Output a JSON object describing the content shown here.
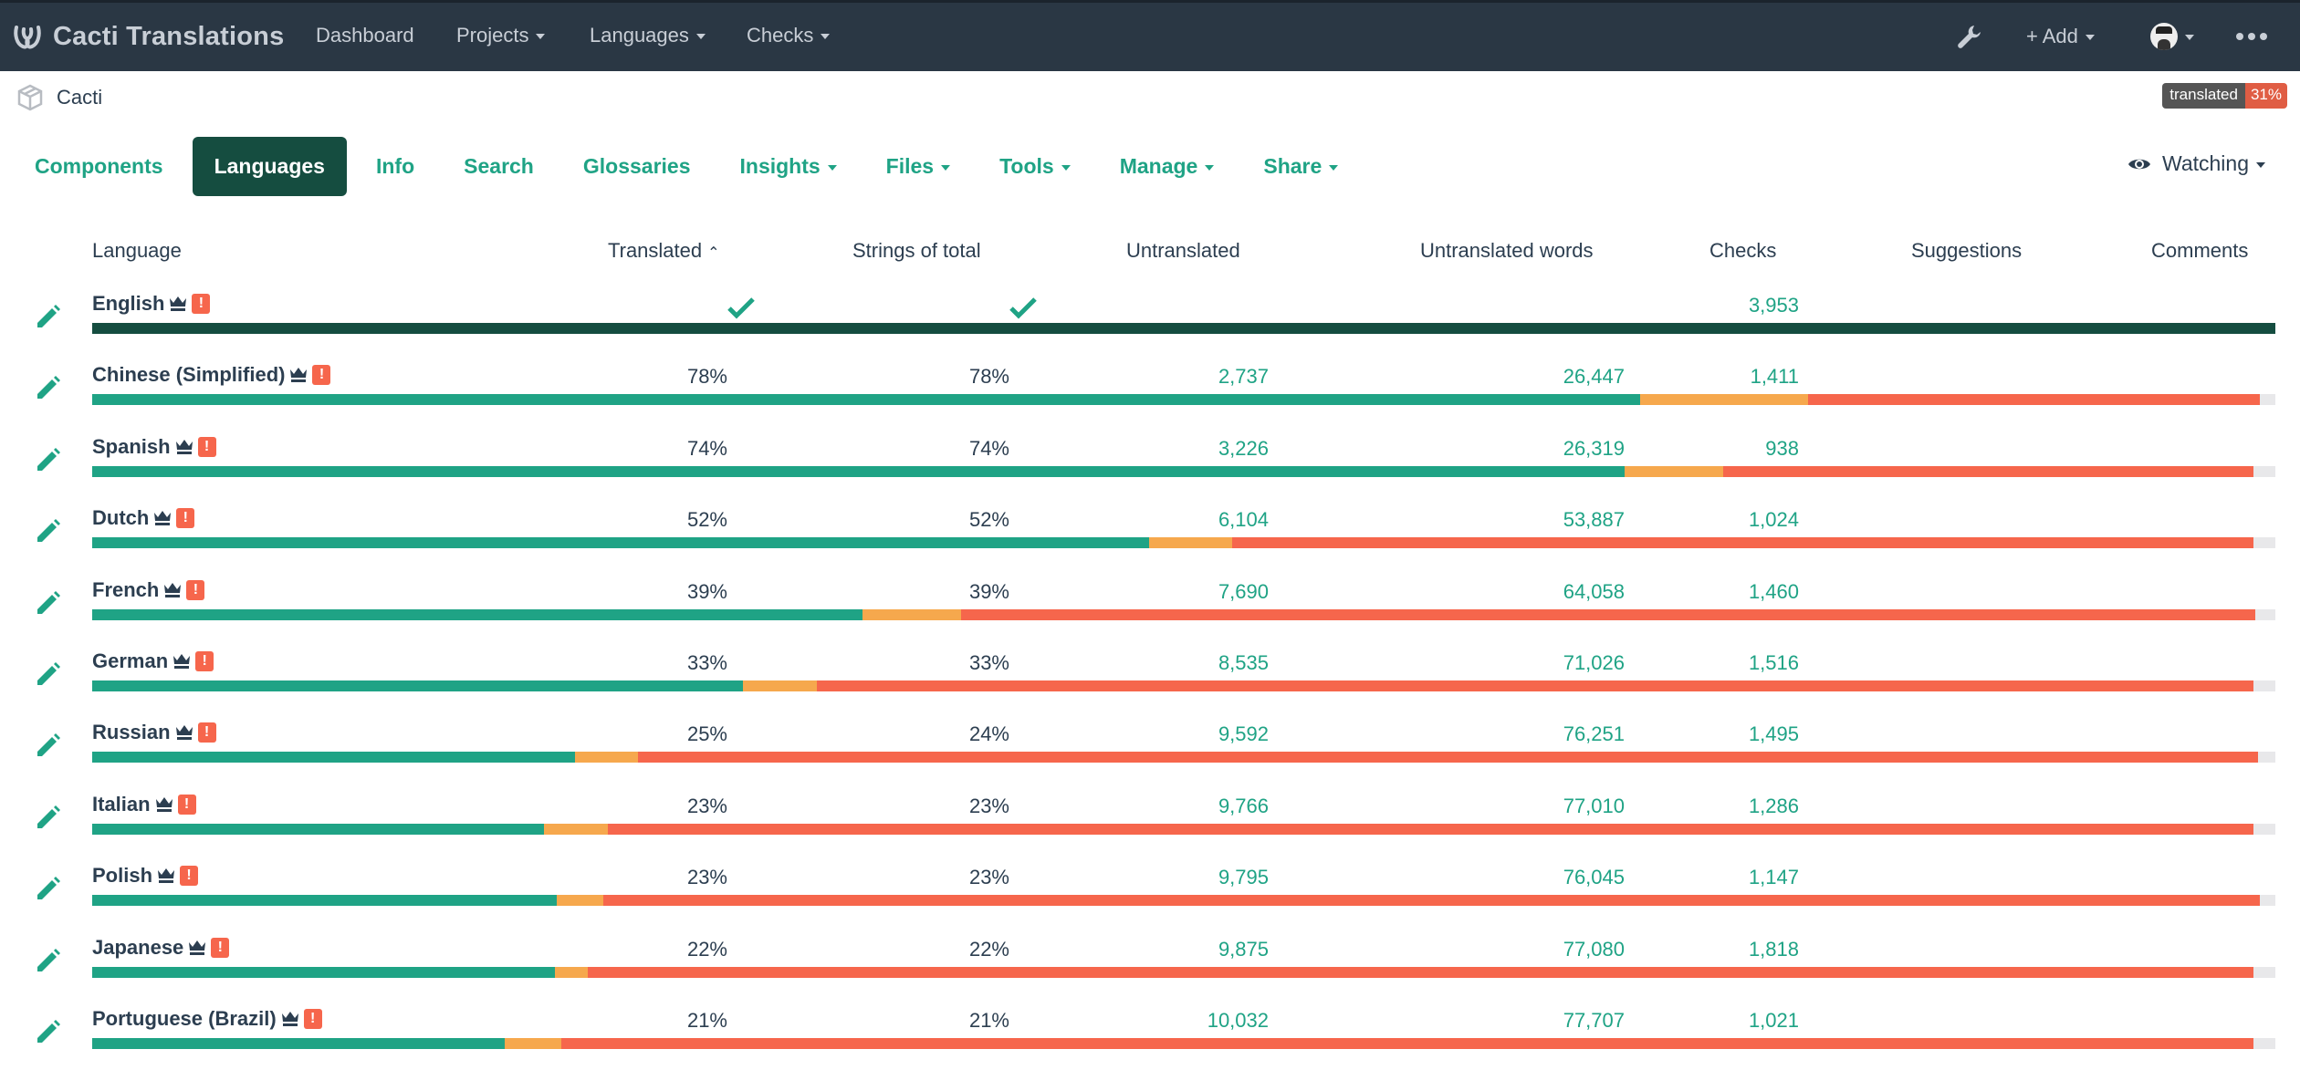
{
  "navbar": {
    "brand": "Cacti Translations",
    "brand_icon": "weblate-logo-icon",
    "links": [
      {
        "label": "Dashboard",
        "dropdown": false
      },
      {
        "label": "Projects",
        "dropdown": true
      },
      {
        "label": "Languages",
        "dropdown": true
      },
      {
        "label": "Checks",
        "dropdown": true
      }
    ],
    "right": {
      "tools_icon": "wrench-icon",
      "add_label": "+ Add",
      "avatar_icon": "user-avatar",
      "more_icon": "ellipsis-icon"
    }
  },
  "breadcrumb": {
    "icon": "project-box-icon",
    "label": "Cacti"
  },
  "status_badge": {
    "label": "translated",
    "value": "31%",
    "value_color": "#e05d44"
  },
  "tabs": [
    {
      "label": "Components",
      "dropdown": false,
      "active": false
    },
    {
      "label": "Languages",
      "dropdown": false,
      "active": true
    },
    {
      "label": "Info",
      "dropdown": false,
      "active": false
    },
    {
      "label": "Search",
      "dropdown": false,
      "active": false
    },
    {
      "label": "Glossaries",
      "dropdown": false,
      "active": false
    },
    {
      "label": "Insights",
      "dropdown": true,
      "active": false
    },
    {
      "label": "Files",
      "dropdown": true,
      "active": false
    },
    {
      "label": "Tools",
      "dropdown": true,
      "active": false
    },
    {
      "label": "Manage",
      "dropdown": true,
      "active": false
    },
    {
      "label": "Share",
      "dropdown": true,
      "active": false
    }
  ],
  "watching": {
    "label": "Watching",
    "icon": "eye-icon"
  },
  "table": {
    "columns": {
      "language": "Language",
      "translated": "Translated",
      "translated_sort": "^",
      "strings_of_total": "Strings of total",
      "untranslated": "Untranslated",
      "untranslated_words": "Untranslated words",
      "checks": "Checks",
      "suggestions": "Suggestions",
      "comments": "Comments"
    },
    "colors": {
      "source_bar": "#154d40",
      "translated": "#1fa385",
      "needs_review": "#f6a84d",
      "untranslated": "#f6664c",
      "empty": "#e8e8ea"
    },
    "rows": [
      {
        "language": "English",
        "source": true,
        "translated": "",
        "strings_of_total": "",
        "untranslated": "",
        "untranslated_words": "",
        "checks": "3,953",
        "suggestions": "",
        "comments": "",
        "progress": {
          "translated": 1.0,
          "review": 0,
          "untranslated": 0
        }
      },
      {
        "language": "Chinese (Simplified)",
        "source": false,
        "translated": "78%",
        "strings_of_total": "78%",
        "untranslated": "2,737",
        "untranslated_words": "26,447",
        "checks": "1,411",
        "suggestions": "",
        "comments": "",
        "progress": {
          "translated": 0.709,
          "review": 0.077,
          "untranslated": 0.207
        }
      },
      {
        "language": "Spanish",
        "source": false,
        "translated": "74%",
        "strings_of_total": "74%",
        "untranslated": "3,226",
        "untranslated_words": "26,319",
        "checks": "938",
        "suggestions": "",
        "comments": "",
        "progress": {
          "translated": 0.702,
          "review": 0.045,
          "untranslated": 0.243
        }
      },
      {
        "language": "Dutch",
        "source": false,
        "translated": "52%",
        "strings_of_total": "52%",
        "untranslated": "6,104",
        "untranslated_words": "53,887",
        "checks": "1,024",
        "suggestions": "",
        "comments": "",
        "progress": {
          "translated": 0.484,
          "review": 0.038,
          "untranslated": 0.468
        }
      },
      {
        "language": "French",
        "source": false,
        "translated": "39%",
        "strings_of_total": "39%",
        "untranslated": "7,690",
        "untranslated_words": "64,058",
        "checks": "1,460",
        "suggestions": "",
        "comments": "",
        "progress": {
          "translated": 0.353,
          "review": 0.045,
          "untranslated": 0.593
        }
      },
      {
        "language": "German",
        "source": false,
        "translated": "33%",
        "strings_of_total": "33%",
        "untranslated": "8,535",
        "untranslated_words": "71,026",
        "checks": "1,516",
        "suggestions": "",
        "comments": "",
        "progress": {
          "translated": 0.298,
          "review": 0.034,
          "untranslated": 0.658
        }
      },
      {
        "language": "Russian",
        "source": false,
        "translated": "25%",
        "strings_of_total": "24%",
        "untranslated": "9,592",
        "untranslated_words": "76,251",
        "checks": "1,495",
        "suggestions": "",
        "comments": "",
        "progress": {
          "translated": 0.221,
          "review": 0.029,
          "untranslated": 0.742
        }
      },
      {
        "language": "Italian",
        "source": false,
        "translated": "23%",
        "strings_of_total": "23%",
        "untranslated": "9,766",
        "untranslated_words": "77,010",
        "checks": "1,286",
        "suggestions": "",
        "comments": "",
        "progress": {
          "translated": 0.207,
          "review": 0.029,
          "untranslated": 0.754
        }
      },
      {
        "language": "Polish",
        "source": false,
        "translated": "23%",
        "strings_of_total": "23%",
        "untranslated": "9,795",
        "untranslated_words": "76,045",
        "checks": "1,147",
        "suggestions": "",
        "comments": "",
        "progress": {
          "translated": 0.213,
          "review": 0.021,
          "untranslated": 0.759
        }
      },
      {
        "language": "Japanese",
        "source": false,
        "translated": "22%",
        "strings_of_total": "22%",
        "untranslated": "9,875",
        "untranslated_words": "77,080",
        "checks": "1,818",
        "suggestions": "",
        "comments": "",
        "progress": {
          "translated": 0.212,
          "review": 0.015,
          "untranslated": 0.763
        }
      },
      {
        "language": "Portuguese (Brazil)",
        "source": false,
        "translated": "21%",
        "strings_of_total": "21%",
        "untranslated": "10,032",
        "untranslated_words": "77,707",
        "checks": "1,021",
        "suggestions": "",
        "comments": "",
        "progress": {
          "translated": 0.189,
          "review": 0.026,
          "untranslated": 0.775
        }
      }
    ]
  }
}
